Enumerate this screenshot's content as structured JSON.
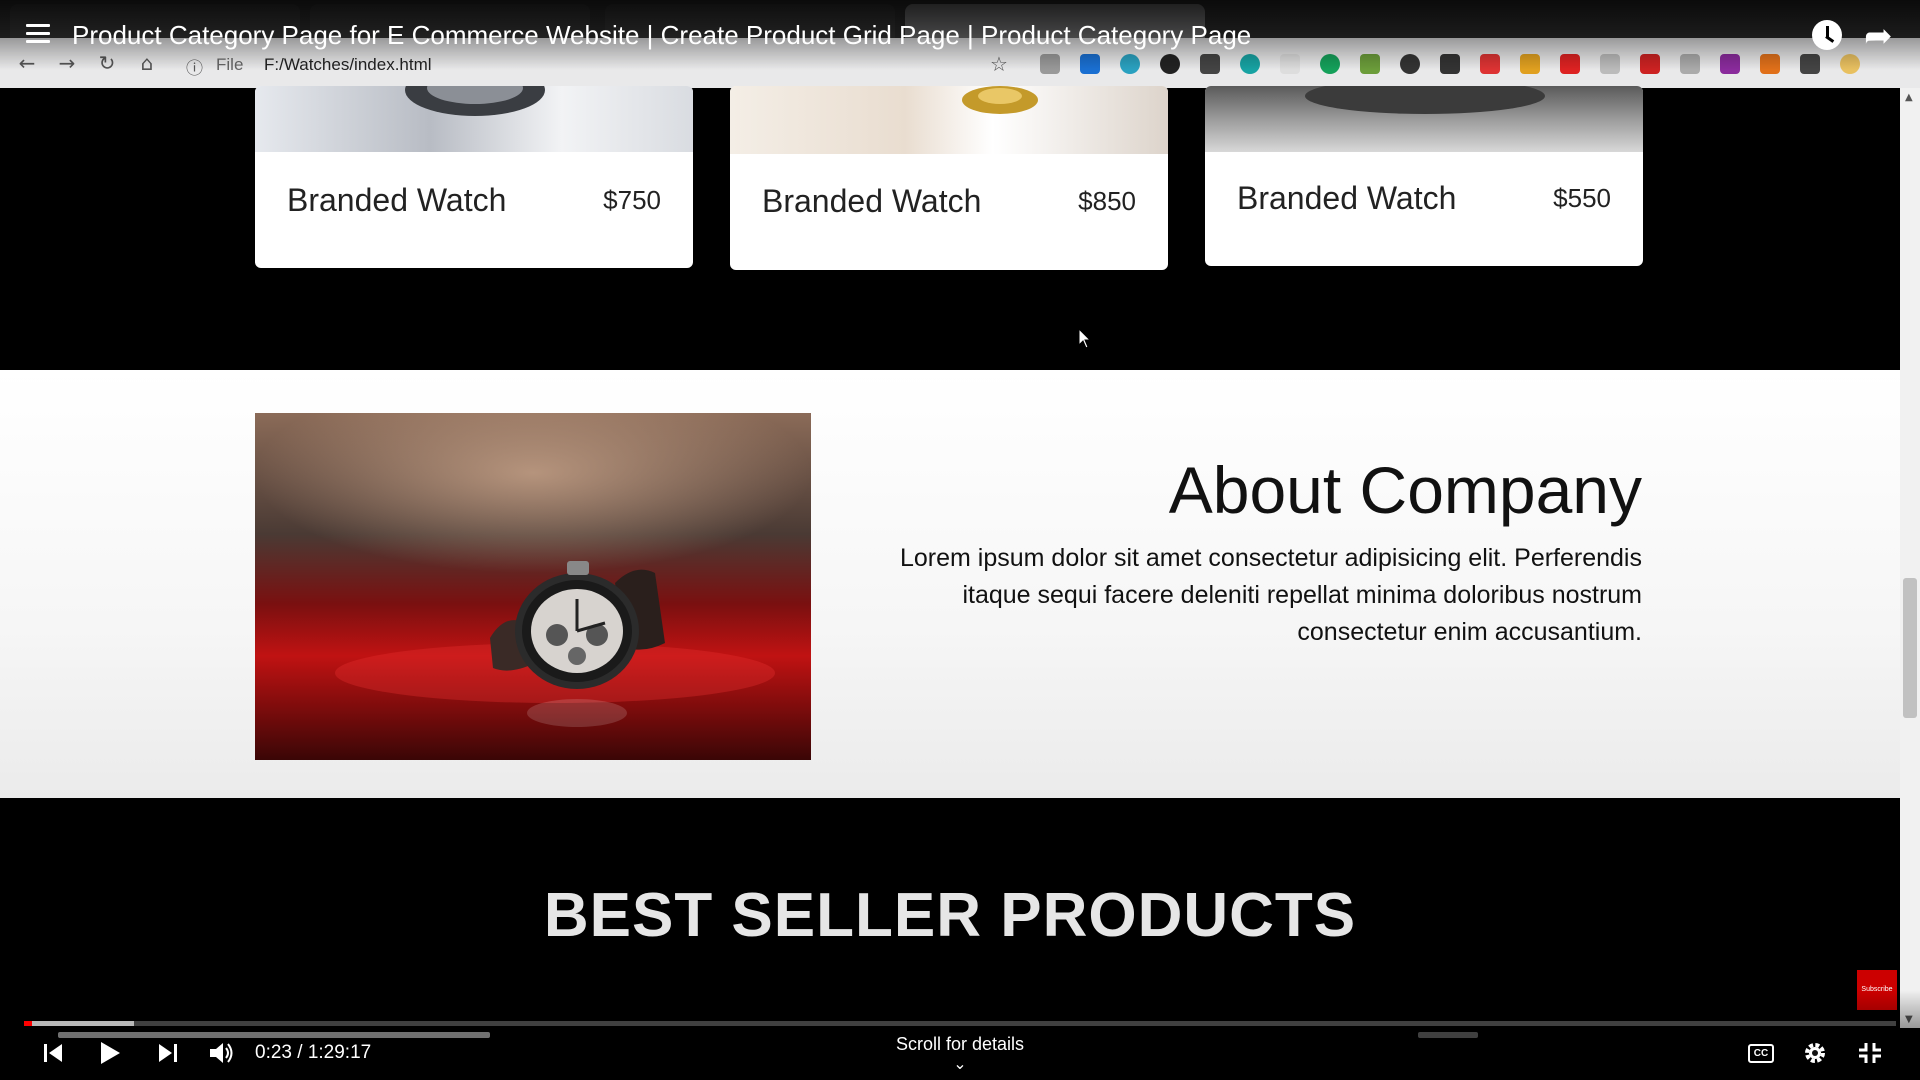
{
  "video": {
    "title": "Product Category Page for E Commerce Website | Create Product Grid Page | Product Category Page",
    "current_time": "0:23",
    "duration": "1:29:17",
    "time_display": "0:23 / 1:29:17",
    "progress_fraction": 0.0043,
    "scroll_hint": "Scroll for details"
  },
  "browser": {
    "url_scheme": "File",
    "url_path": "F:/Watches/index.html"
  },
  "products": [
    {
      "name": "Branded Watch",
      "price": "$750"
    },
    {
      "name": "Branded Watch",
      "price": "$850"
    },
    {
      "name": "Branded Watch",
      "price": "$550"
    }
  ],
  "about": {
    "title": "About Company",
    "text": "Lorem ipsum dolor sit amet consectetur adipisicing elit. Perferendis itaque sequi facere deleniti repellat minima doloribus nostrum consectetur enim accusantium."
  },
  "best_seller": {
    "title": "BEST SELLER PRODUCTS"
  },
  "colors": {
    "section_dark": "#000000",
    "section_light": "#ffffff",
    "progress": "#ff0000",
    "subscribe": "#cc0000"
  },
  "icons": [
    "menu-icon",
    "watch-later-icon",
    "share-icon",
    "back-icon",
    "forward-icon",
    "reload-icon",
    "home-icon",
    "info-icon",
    "bookmark-star-icon",
    "previous-icon",
    "play-icon",
    "next-icon",
    "volume-icon",
    "captions-icon",
    "settings-icon",
    "exit-fullscreen-icon"
  ]
}
